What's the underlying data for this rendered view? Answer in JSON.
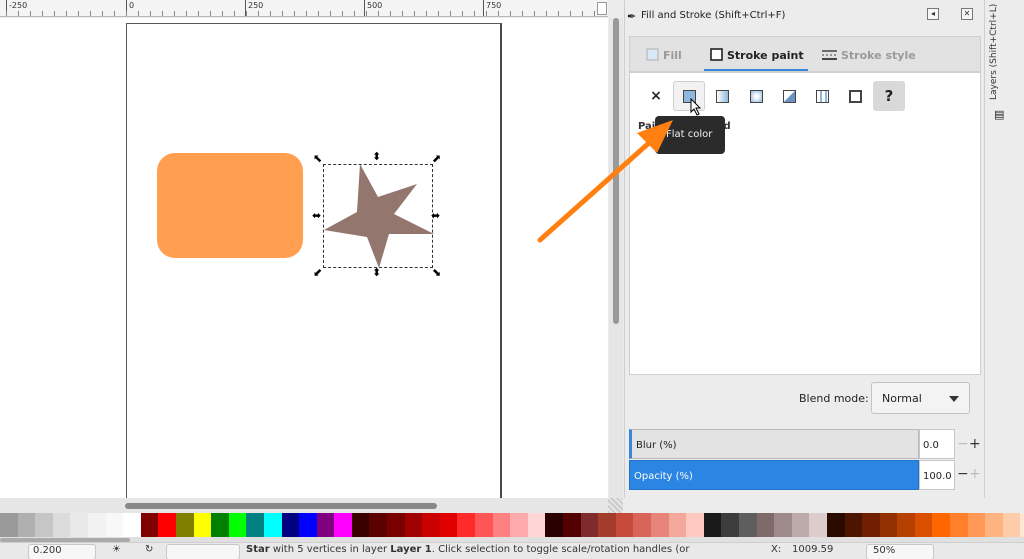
{
  "ruler": {
    "labels": [
      "-250",
      "0",
      "250",
      "500",
      "750"
    ]
  },
  "dialog": {
    "title": "Fill and Stroke (Shift+Ctrl+F)",
    "tabs": [
      {
        "label": "Fill",
        "state": "inactive"
      },
      {
        "label": "Stroke paint",
        "state": "active"
      },
      {
        "label": "Stroke style",
        "state": "inactive"
      }
    ],
    "paint_buttons": [
      "no-paint",
      "flat-color",
      "linear-gradient",
      "radial-gradient",
      "mesh-gradient",
      "pattern",
      "swatch",
      "unset"
    ],
    "unset_label": "?",
    "none_label": "×",
    "paint_label": "Pai",
    "paint_value": "undefined",
    "tooltip": "Flat color",
    "blend_label": "Blend mode:",
    "blend_value": "Normal",
    "blur_label": "Blur (%)",
    "blur_value": "0.0",
    "opacity_label": "Opacity (%)",
    "opacity_value": "100.0",
    "minus_symbol": "−",
    "plus_symbol": "+"
  },
  "sidebar": {
    "layers_label": "Layers (Shift+Ctrl+L)"
  },
  "statusbar": {
    "zoom_value": "0.200",
    "status_bold_1": "Star",
    "status_text_1": " with 5 vertices in layer ",
    "status_bold_2": "Layer 1",
    "status_text_2": ". Click selection to toggle scale/rotation handles (or",
    "x_label": "X:",
    "x_value": "1009.59",
    "zoom_percent": "50%"
  },
  "canvas_objects": {
    "rect_color": "#ff9f4f",
    "star_color": "#93766e"
  },
  "palette": [
    "#9a9a9a",
    "#b0b0b0",
    "#c6c6c6",
    "#dcdcdc",
    "#e9e9e9",
    "#f2f2f2",
    "#f8f8f8",
    "#ffffff",
    "#800000",
    "#ff0000",
    "#808000",
    "#ffff00",
    "#008000",
    "#00ff00",
    "#008080",
    "#00ffff",
    "#000080",
    "#0000ff",
    "#800080",
    "#ff00ff",
    "#3a0000",
    "#5a0000",
    "#7a0000",
    "#a00000",
    "#c80000",
    "#e00000",
    "#ff2a2a",
    "#ff5555",
    "#ff8080",
    "#ffaaaa",
    "#ffd5d5",
    "#2b0000",
    "#550000",
    "#802b2b",
    "#a33c2b",
    "#c84a3a",
    "#d9645a",
    "#e8857a",
    "#f4a79b",
    "#ffc9bf",
    "#1a1a1a",
    "#3c3c3c",
    "#5e5e5e",
    "#7f6a6a",
    "#9e8a8a",
    "#bdaaaa",
    "#dccccc",
    "#2b0a00",
    "#4d1500",
    "#702000",
    "#933000",
    "#b54000",
    "#d85000",
    "#ff6600",
    "#ff7f2a",
    "#ff9955",
    "#ffb380",
    "#ffccaa",
    "#ffe6d5",
    "#fff0e6"
  ]
}
